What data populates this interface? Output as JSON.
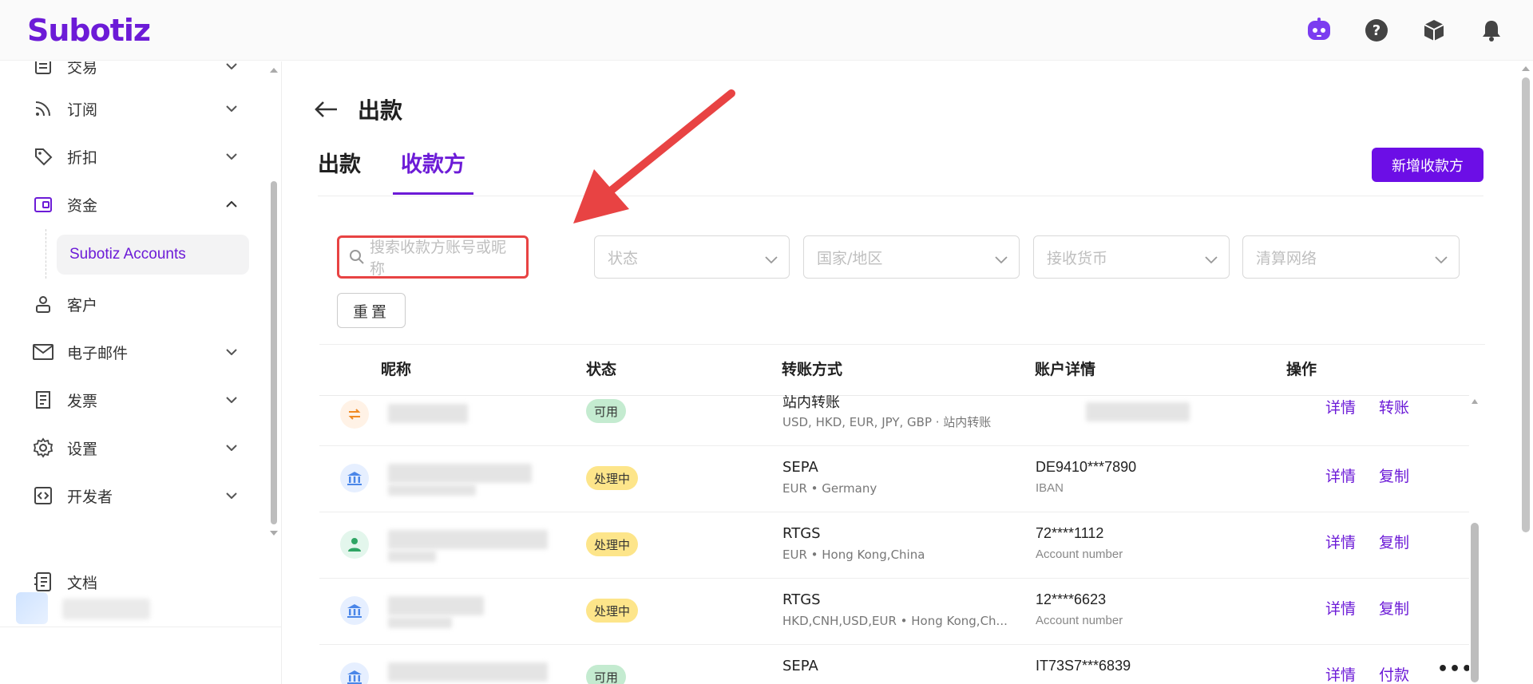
{
  "app": {
    "logo": "Subotiz"
  },
  "colors": {
    "accent": "#6c1bd7",
    "annotation": "#e84343"
  },
  "header": {
    "icons": [
      "ai-assistant-icon",
      "help-icon",
      "package-icon",
      "bell-icon"
    ]
  },
  "sidebar": {
    "items": [
      {
        "label": "交易",
        "icon": "list-icon"
      },
      {
        "label": "订阅",
        "icon": "rss-icon"
      },
      {
        "label": "折扣",
        "icon": "tag-icon"
      },
      {
        "label": "资金",
        "icon": "wallet-icon"
      },
      {
        "label": "客户",
        "icon": "user-icon"
      },
      {
        "label": "电子邮件",
        "icon": "mail-icon"
      },
      {
        "label": "发票",
        "icon": "invoice-icon"
      },
      {
        "label": "设置",
        "icon": "gear-icon"
      },
      {
        "label": "开发者",
        "icon": "code-icon"
      },
      {
        "label": "文档",
        "icon": "doc-icon"
      }
    ],
    "sub_item": "Subotiz Accounts"
  },
  "page": {
    "title": "出款",
    "tabs": [
      "出款",
      "收款方"
    ],
    "active_tab": "收款方",
    "add_button": "新增收款方",
    "reset_button": "重置"
  },
  "filters": {
    "search_placeholder": "搜索收款方账号或昵称",
    "status": "状态",
    "country": "国家/地区",
    "currency": "接收货币",
    "network": "清算网络"
  },
  "table": {
    "headers": [
      "昵称",
      "状态",
      "转账方式",
      "账户详情",
      "操作"
    ],
    "rows": [
      {
        "icon": "transfer-icon",
        "status": "可用",
        "status_type": "ok",
        "method": "站内转账",
        "method_sub": "USD, HKD, EUR, JPY, GBP · 站内转账",
        "account": "",
        "account_sub": "",
        "actions": [
          "详情",
          "转账"
        ]
      },
      {
        "icon": "bank-icon",
        "status": "处理中",
        "status_type": "pending",
        "method": "SEPA",
        "method_sub": "EUR • Germany",
        "account": "DE9410***7890",
        "account_sub": "IBAN",
        "actions": [
          "详情",
          "复制"
        ]
      },
      {
        "icon": "person-icon",
        "status": "处理中",
        "status_type": "pending",
        "method": "RTGS",
        "method_sub": "EUR • Hong Kong,China",
        "account": "72****1112",
        "account_sub": "Account number",
        "actions": [
          "详情",
          "复制"
        ]
      },
      {
        "icon": "bank-icon",
        "status": "处理中",
        "status_type": "pending",
        "method": "RTGS",
        "method_sub": "HKD,CNH,USD,EUR • Hong Kong,Ch...",
        "account": "12****6623",
        "account_sub": "Account number",
        "actions": [
          "详情",
          "复制"
        ]
      },
      {
        "icon": "bank-icon",
        "status": "可用",
        "status_type": "ok",
        "method": "SEPA",
        "method_sub": "",
        "account": "IT73S7***6839",
        "account_sub": "",
        "actions": [
          "详情",
          "付款"
        ],
        "more": "•••"
      }
    ]
  }
}
